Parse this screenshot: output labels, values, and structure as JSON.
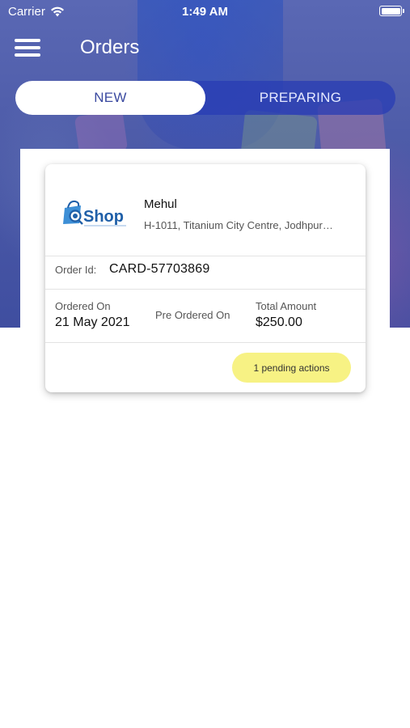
{
  "status_bar": {
    "carrier": "Carrier",
    "time": "1:49 AM"
  },
  "header": {
    "title": "Orders"
  },
  "tabs": [
    {
      "label": "NEW",
      "active": true
    },
    {
      "label": "PREPARING",
      "active": false
    }
  ],
  "order": {
    "store_logo_text": "Shop",
    "customer_name": "Mehul",
    "address": "H-1011, Titanium City Centre, Jodhpur…",
    "order_id_label": "Order Id:",
    "order_id": "CARD-57703869",
    "ordered_on_label": "Ordered On",
    "ordered_on": "21 May 2021",
    "pre_ordered_on_label": "Pre Ordered On",
    "total_amount_label": "Total Amount",
    "total_amount": "$250.00",
    "pending_actions": "1 pending actions"
  },
  "colors": {
    "accent": "#3b4aa0",
    "pending_badge": "#f7f284",
    "logo_blue": "#1f5fa8"
  },
  "icons": [
    "wifi-icon",
    "battery-icon",
    "menu-icon",
    "shop-logo"
  ]
}
